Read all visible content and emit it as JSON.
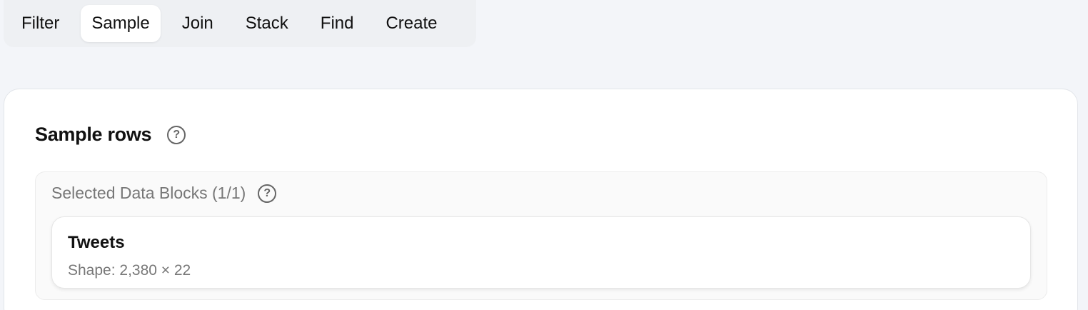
{
  "tabs": {
    "filter": "Filter",
    "sample": "Sample",
    "join": "Join",
    "stack": "Stack",
    "find": "Find",
    "create": "Create",
    "active": "Sample"
  },
  "panel": {
    "title": "Sample rows",
    "help_icon": "question-circle-icon"
  },
  "selected_blocks": {
    "title": "Selected Data Blocks (1/1)",
    "help_icon": "question-circle-icon",
    "items": [
      {
        "name": "Tweets",
        "shape": "Shape: 2,380 × 22"
      }
    ]
  }
}
